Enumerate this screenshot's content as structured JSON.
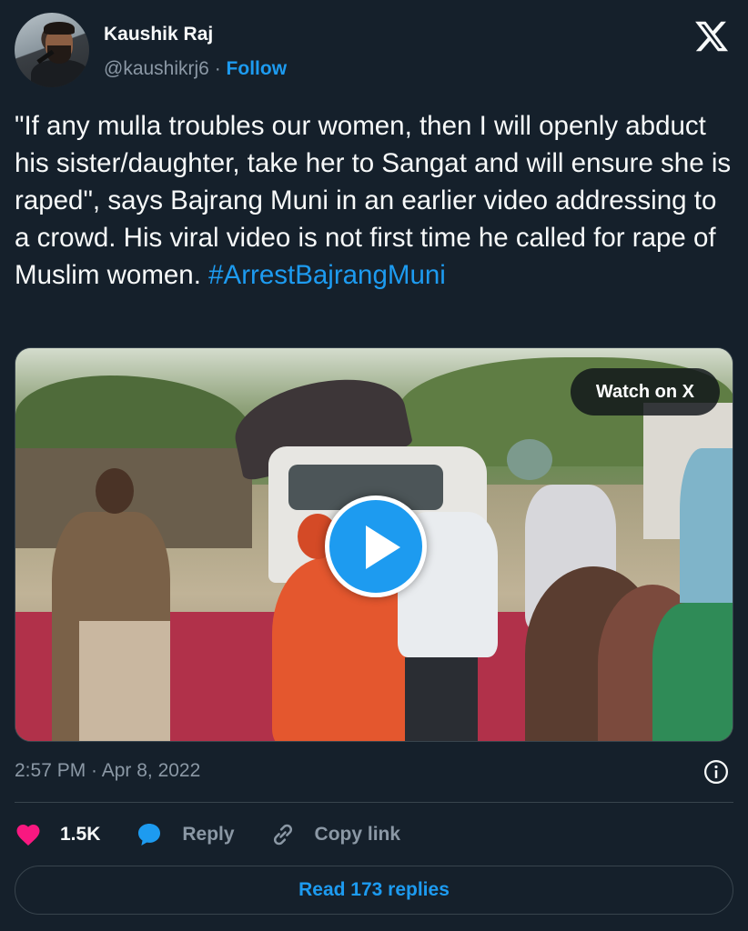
{
  "author": {
    "name": "Kaushik Raj",
    "handle": "@kaushikrj6",
    "separator": "·",
    "follow_label": "Follow"
  },
  "tweet": {
    "text": "\"If any mulla troubles our women, then I will openly abduct his sister/daughter, take her to Sangat and will ensure she is raped\", says Bajrang Muni in an earlier video addressing to a crowd. His viral video is not first time he called for rape of Muslim women.",
    "hashtag": "#ArrestBajrangMuni"
  },
  "media": {
    "watch_label": "Watch on X",
    "play_icon": "play-icon"
  },
  "timestamp": "2:57 PM · Apr 8, 2022",
  "actions": {
    "like_count": "1.5K",
    "reply_label": "Reply",
    "copy_label": "Copy link"
  },
  "read_replies_label": "Read 173 replies",
  "colors": {
    "background": "#15202b",
    "accent": "#1d9bf0",
    "like": "#f91880",
    "muted": "#8b98a5"
  }
}
